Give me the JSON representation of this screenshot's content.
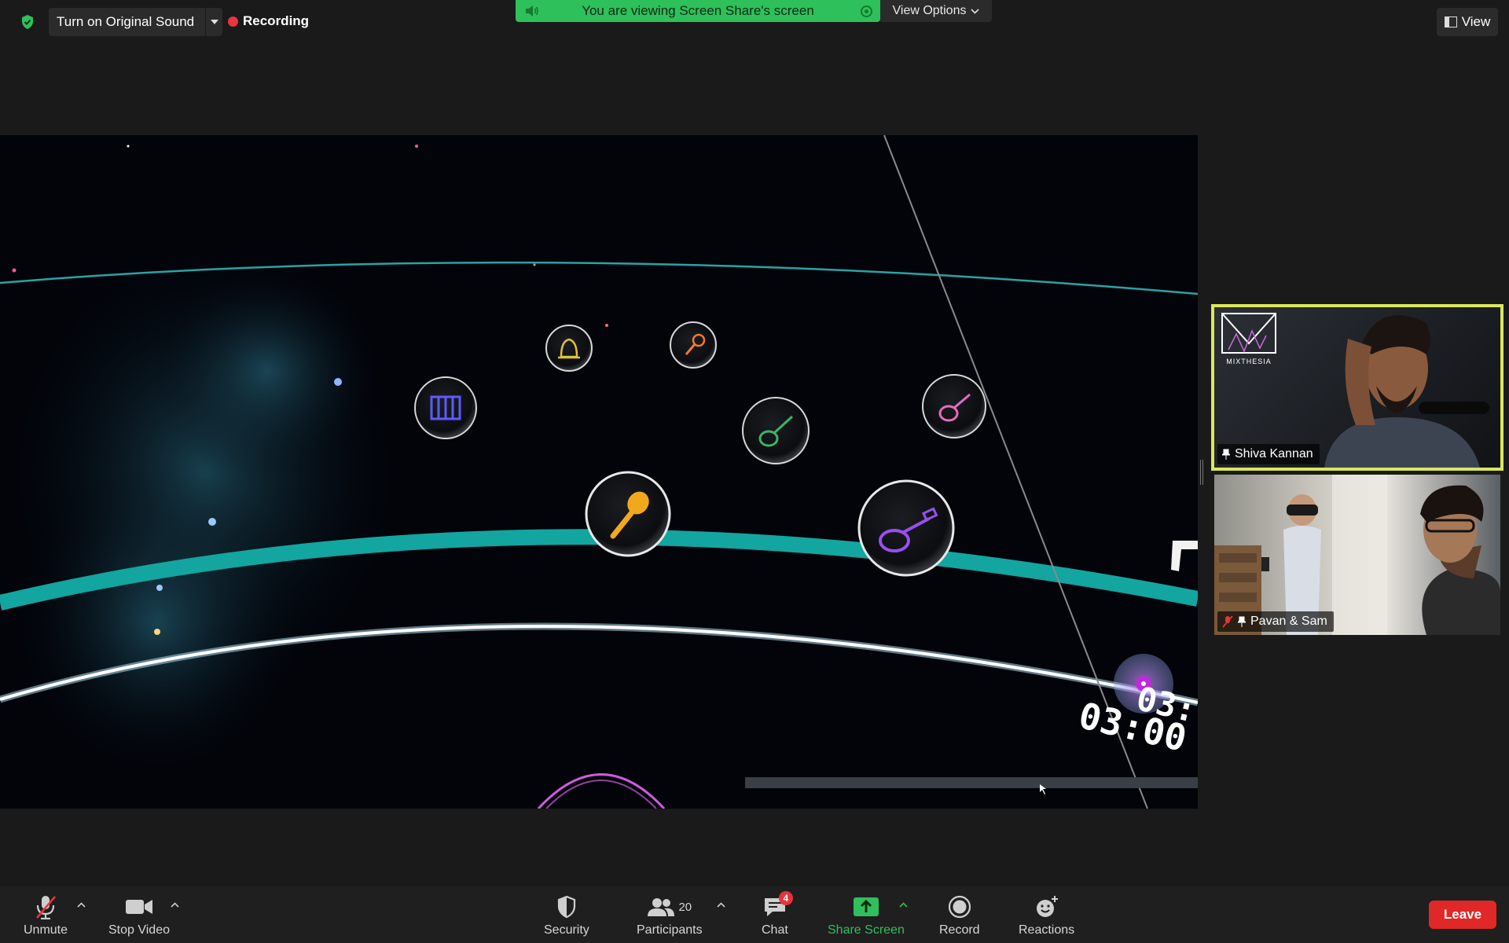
{
  "top": {
    "original_sound": "Turn on Original Sound",
    "recording": "Recording",
    "share_banner": "You are viewing Screen Share's screen",
    "view_options": "View Options",
    "view": "View"
  },
  "stage": {
    "time_text": "03:00",
    "time_text_partial": "03:"
  },
  "participants": [
    {
      "name": "Shiva Kannan",
      "logo_text": "MIXTHESIA",
      "active_speaker": true
    },
    {
      "name": "Pavan & Sam",
      "muted": true
    }
  ],
  "toolbar": {
    "unmute": "Unmute",
    "stop_video": "Stop Video",
    "security": "Security",
    "participants": "Participants",
    "participants_count": "20",
    "chat": "Chat",
    "chat_badge": "4",
    "share_screen": "Share Screen",
    "record": "Record",
    "reactions": "Reactions",
    "leave": "Leave"
  },
  "colors": {
    "banner_green": "#2ec05a",
    "speaker_border": "#d9e85a",
    "leave_red": "#e02828",
    "record_red": "#e8363c"
  }
}
